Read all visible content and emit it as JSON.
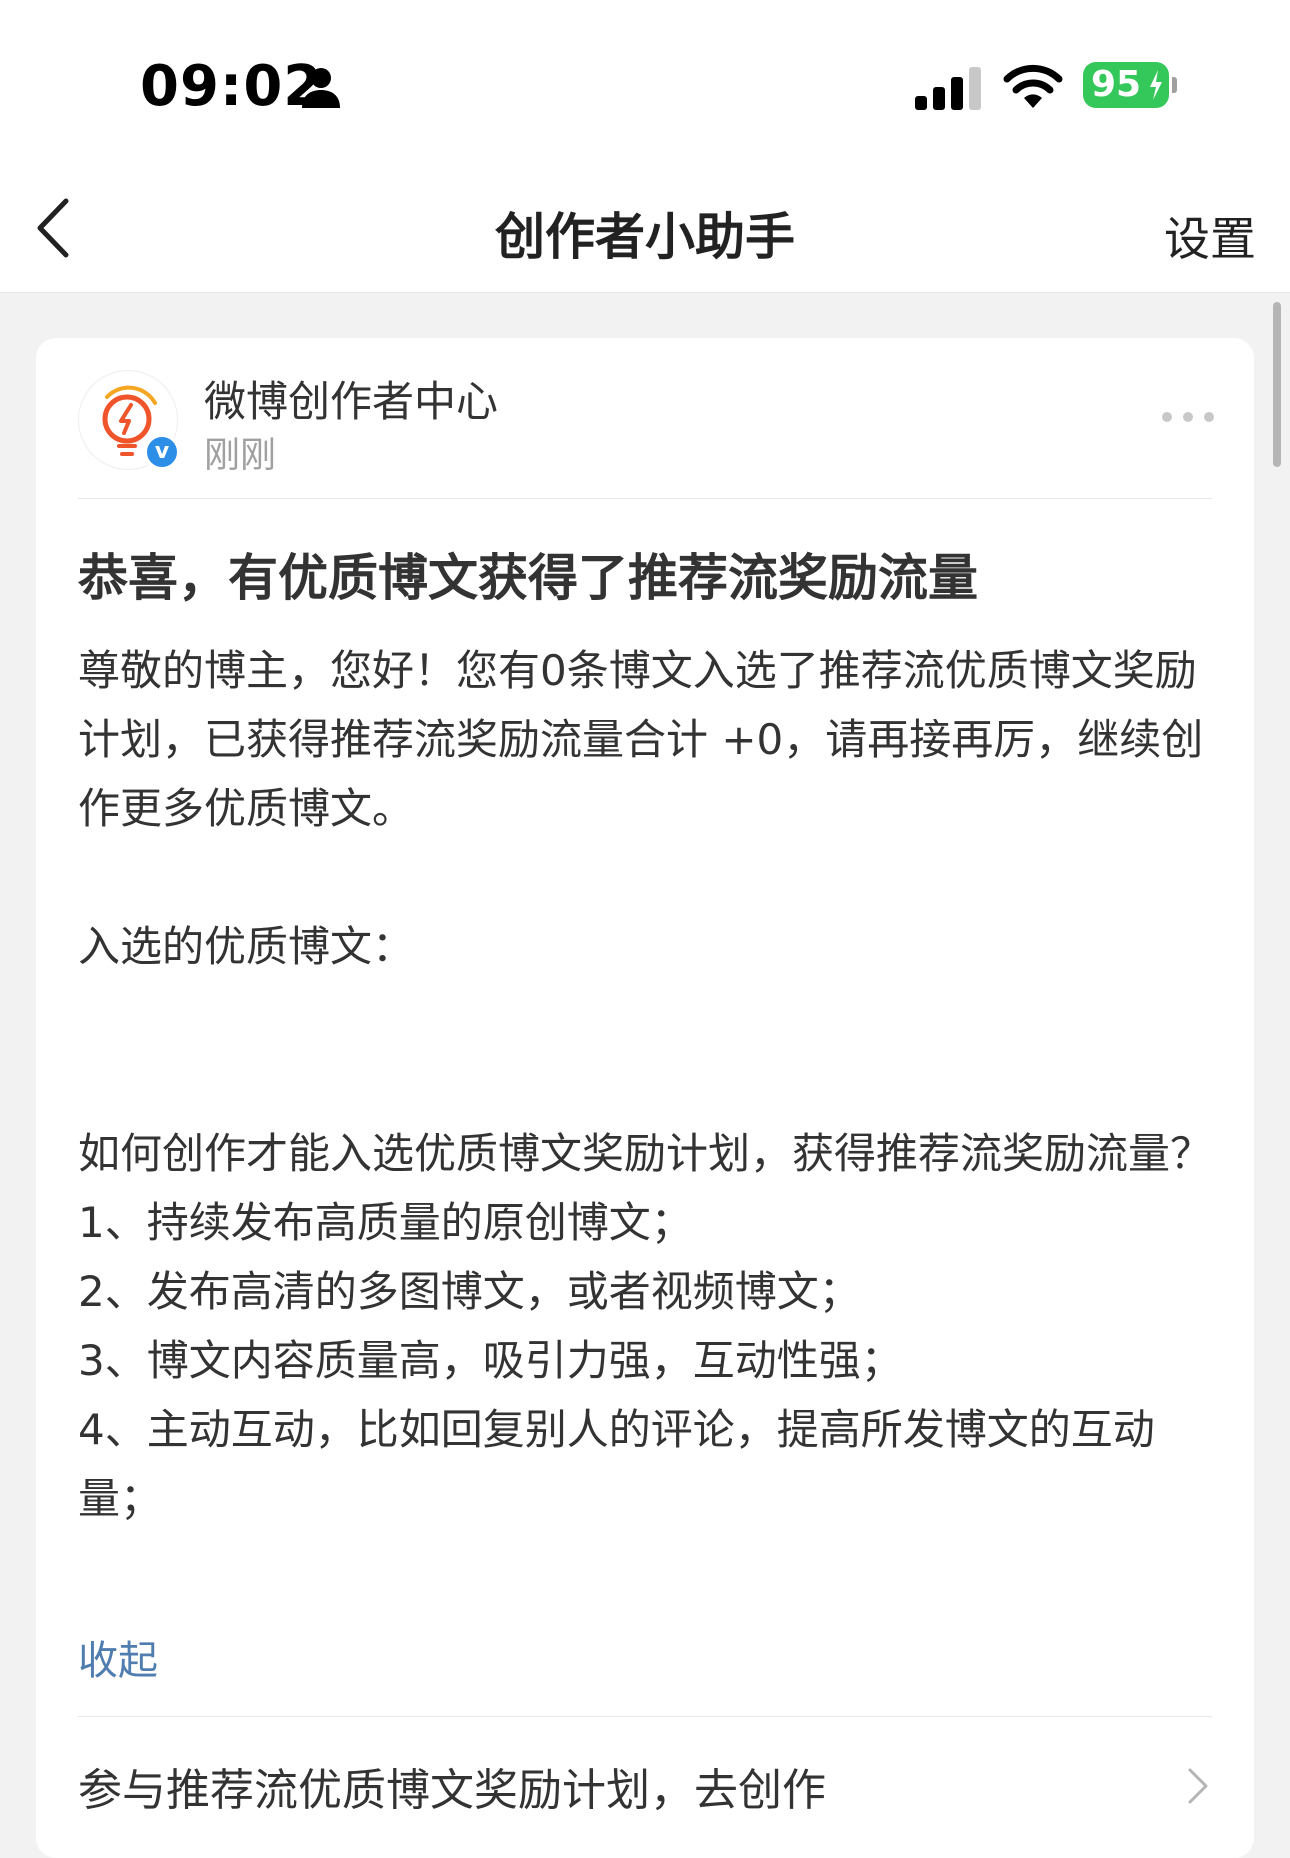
{
  "status_bar": {
    "time": "09:02",
    "battery": "95"
  },
  "nav": {
    "title": "创作者小助手",
    "settings_label": "设置"
  },
  "card": {
    "author": "微博创作者中心",
    "time": "刚刚",
    "verified": "v",
    "title": "恭喜，有优质博文获得了推荐流奖励流量",
    "body": {
      "intro": "尊敬的博主，您好！您有0条博文入选了推荐流优质博文奖励计划，已获得推荐流奖励流量合计 +0，请再接再厉，继续创作更多优质博文。",
      "selected_label": "入选的优质博文：",
      "how_question": "如何创作才能入选优质博文奖励计划，获得推荐流奖励流量？",
      "tips": [
        "1、持续发布高质量的原创博文；",
        "2、发布高清的多图博文，或者视频博文；",
        "3、博文内容质量高，吸引力强，互动性强；",
        "4、主动互动，比如回复别人的评论，提高所发博文的互动量；"
      ]
    },
    "collapse_label": "收起",
    "cta_label": "参与推荐流优质博文奖励计划，去创作"
  },
  "colors": {
    "link": "#507daf",
    "battery": "#34c759",
    "verified": "#2d8ee8",
    "logo": "#f5a623"
  },
  "icons": [
    "person-icon",
    "signal-icon",
    "wifi-icon",
    "battery-bolt-icon",
    "back-icon",
    "more-icon",
    "verified-icon",
    "chevron-right-icon"
  ]
}
